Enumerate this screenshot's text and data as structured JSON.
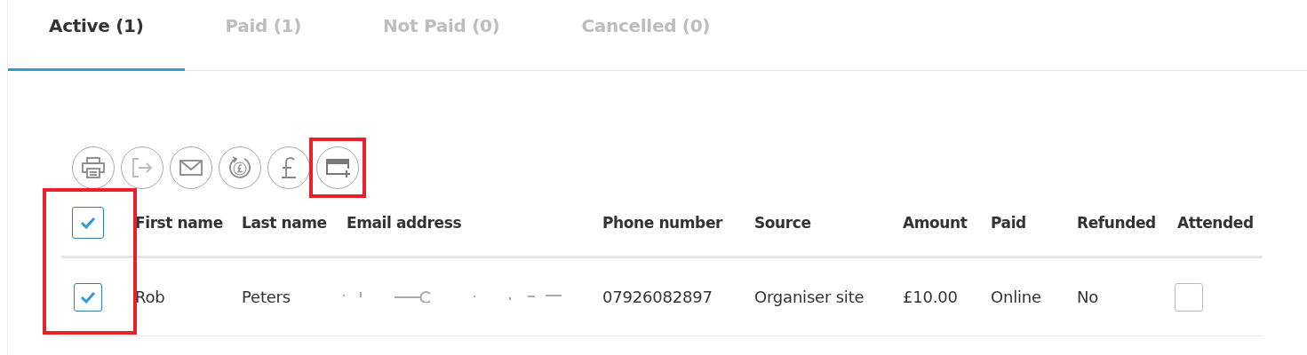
{
  "tabs": [
    {
      "label": "Active (1)",
      "selected": true
    },
    {
      "label": "Paid (1)",
      "selected": false
    },
    {
      "label": "Not Paid (0)",
      "selected": false
    },
    {
      "label": "Cancelled (0)",
      "selected": false
    }
  ],
  "toolbar": [
    {
      "kind": "print",
      "highlighted": false
    },
    {
      "kind": "export",
      "highlighted": false
    },
    {
      "kind": "email",
      "highlighted": false
    },
    {
      "kind": "refund",
      "highlighted": false
    },
    {
      "kind": "pound",
      "highlighted": false
    },
    {
      "kind": "card_add",
      "highlighted": true
    }
  ],
  "table": {
    "select_column_highlighted": true,
    "all_selected": true,
    "columns": [
      "First name",
      "Last name",
      "Email address",
      "Phone number",
      "Source",
      "Amount",
      "Paid",
      "Refunded",
      "Attended"
    ],
    "rows": [
      {
        "selected": true,
        "first_name": "Rob",
        "last_name": "Peters",
        "email_redacted": true,
        "phone": "07926082897",
        "source": "Organiser site",
        "amount": "£10.00",
        "paid": "Online",
        "refunded": "No",
        "attended": false
      }
    ]
  }
}
